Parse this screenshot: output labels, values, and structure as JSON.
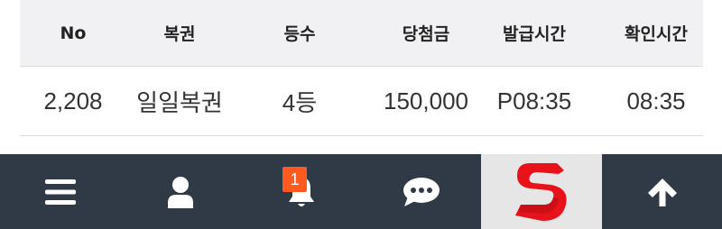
{
  "table": {
    "headers": {
      "no": "No",
      "name": "복권",
      "rank": "등수",
      "prize": "당첨금",
      "issue_time": "발급시간",
      "check_time": "확인시간"
    },
    "rows": [
      {
        "no": "2,208",
        "name": "일일복권",
        "rank": "4등",
        "prize": "150,000",
        "issue_time": "P08:35",
        "check_time": "08:35"
      }
    ]
  },
  "navbar": {
    "items": [
      {
        "icon": "menu-icon"
      },
      {
        "icon": "user-icon"
      },
      {
        "icon": "bell-icon",
        "badge": "1"
      },
      {
        "icon": "chat-icon"
      },
      {
        "icon": "s-logo",
        "logo_letter": "S"
      },
      {
        "icon": "arrow-up-icon"
      }
    ],
    "colors": {
      "background": "#2f3a46",
      "badge": "#ff5a1f",
      "logo_bg": "#e6e6e6",
      "logo_red": "#e8121b"
    }
  }
}
